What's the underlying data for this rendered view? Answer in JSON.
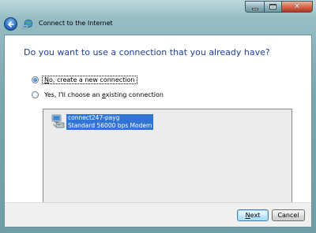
{
  "window": {
    "title": "Connect to the Internet",
    "caption_buttons": [
      "minimize-icon",
      "maximize-icon",
      "close-icon"
    ],
    "close_glyph": "✕",
    "back_icon": "back-arrow-icon",
    "title_icon": "network-globe-icon"
  },
  "page": {
    "heading": "Do you want to use a connection that you already have?"
  },
  "options": [
    {
      "label_pre": "",
      "label_key": "N",
      "label_post": "o, create a new connection",
      "checked": true,
      "focused": true
    },
    {
      "label_pre": "Yes, I'll choose an ",
      "label_key": "e",
      "label_post": "xisting connection",
      "checked": false,
      "focused": false
    }
  ],
  "connections": [
    {
      "name": "connect247-payg",
      "device": "Standard 56000 bps Modem",
      "selected": true,
      "icon": "dialup-connection-icon"
    }
  ],
  "buttons": {
    "next_key": "N",
    "next_rest": "ext",
    "cancel": "Cancel"
  },
  "colors": {
    "heading": "#1e3f9a",
    "selection": "#3174d4",
    "list_background": "#ececec"
  }
}
